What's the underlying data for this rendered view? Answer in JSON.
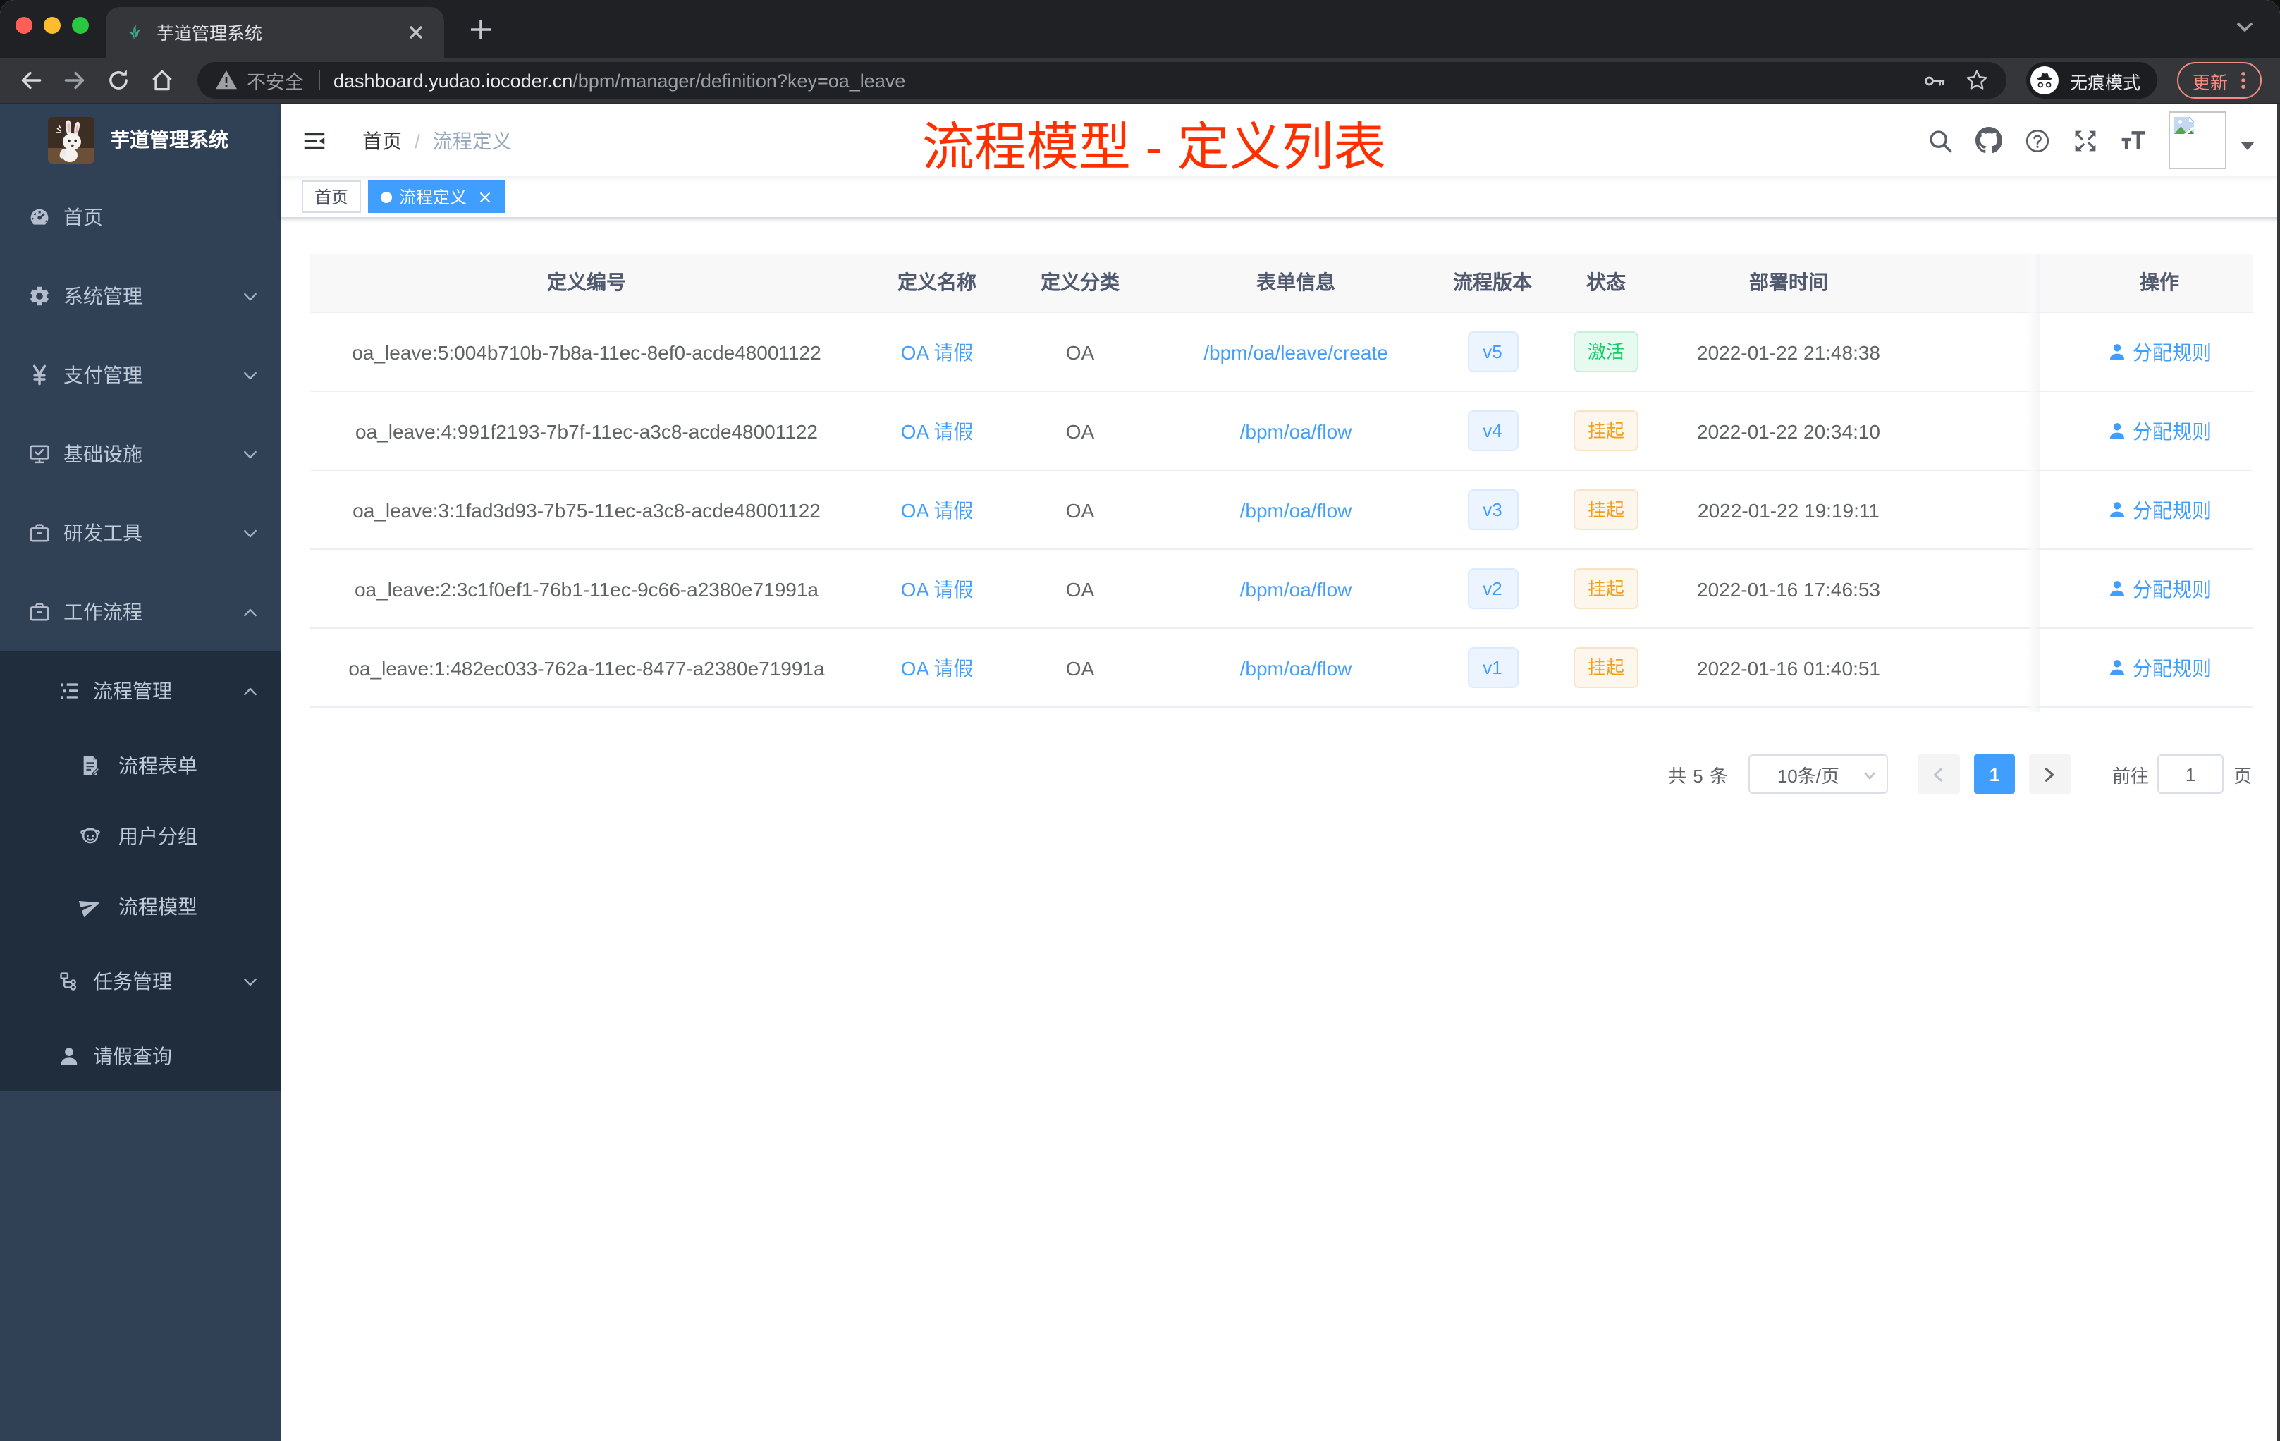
{
  "accent": {
    "blue": "#409eff",
    "green": "#13ce66",
    "orange": "#f0a020",
    "red_annotation": "#ff3000",
    "sidebar_bg": "#304156",
    "sidebar_sub_bg": "#1f2d3d"
  },
  "browser": {
    "tab_title": "芋道管理系统",
    "security_label": "不安全",
    "url_host": "dashboard.yudao.iocoder.cn",
    "url_path": "/bpm/manager/definition?key=oa_leave",
    "incognito_label": "无痕模式",
    "update_label": "更新"
  },
  "sidebar": {
    "logo_title": "芋道管理系统",
    "items": [
      {
        "label": "首页",
        "icon": "dashboard",
        "level": 1,
        "arrow": "",
        "dark": false
      },
      {
        "label": "系统管理",
        "icon": "gear",
        "level": 1,
        "arrow": "down",
        "dark": false
      },
      {
        "label": "支付管理",
        "icon": "yen",
        "level": 1,
        "arrow": "down",
        "dark": false
      },
      {
        "label": "基础设施",
        "icon": "monitor",
        "level": 1,
        "arrow": "down",
        "dark": false
      },
      {
        "label": "研发工具",
        "icon": "briefcase",
        "level": 1,
        "arrow": "down",
        "dark": false
      },
      {
        "label": "工作流程",
        "icon": "briefcase",
        "level": 1,
        "arrow": "up",
        "dark": false
      },
      {
        "label": "流程管理",
        "icon": "tree-list",
        "level": 2,
        "arrow": "up",
        "dark": true
      },
      {
        "label": "流程表单",
        "icon": "form-doc",
        "level": 3,
        "arrow": "",
        "dark": true
      },
      {
        "label": "用户分组",
        "icon": "user-group",
        "level": 3,
        "arrow": "",
        "dark": true
      },
      {
        "label": "流程模型",
        "icon": "paper-plane",
        "level": 3,
        "arrow": "",
        "dark": true
      },
      {
        "label": "任务管理",
        "icon": "flow-tree",
        "level": 2,
        "arrow": "down",
        "dark": true
      },
      {
        "label": "请假查询",
        "icon": "user",
        "level": 2,
        "arrow": "",
        "dark": true,
        "short": true
      }
    ]
  },
  "header": {
    "breadcrumb_home": "首页",
    "breadcrumb_separator": "/",
    "breadcrumb_current": "流程定义",
    "annotation": "流程模型 - 定义列表"
  },
  "tags": [
    {
      "label": "首页",
      "active": false,
      "closable": false
    },
    {
      "label": "流程定义",
      "active": true,
      "closable": true
    }
  ],
  "table": {
    "columns": [
      "定义编号",
      "定义名称",
      "定义分类",
      "表单信息",
      "流程版本",
      "状态",
      "部署时间",
      "操作"
    ],
    "rows": [
      {
        "id": "oa_leave:5:004b710b-7b8a-11ec-8ef0-acde48001122",
        "name": "OA 请假",
        "category": "OA",
        "form": "/bpm/oa/leave/create",
        "version": "v5",
        "status": "激活",
        "status_type": "success",
        "deployed": "2022-01-22 21:48:38",
        "action": "分配规则"
      },
      {
        "id": "oa_leave:4:991f2193-7b7f-11ec-a3c8-acde48001122",
        "name": "OA 请假",
        "category": "OA",
        "form": "/bpm/oa/flow",
        "version": "v4",
        "status": "挂起",
        "status_type": "warning",
        "deployed": "2022-01-22 20:34:10",
        "action": "分配规则"
      },
      {
        "id": "oa_leave:3:1fad3d93-7b75-11ec-a3c8-acde48001122",
        "name": "OA 请假",
        "category": "OA",
        "form": "/bpm/oa/flow",
        "version": "v3",
        "status": "挂起",
        "status_type": "warning",
        "deployed": "2022-01-22 19:19:11",
        "action": "分配规则"
      },
      {
        "id": "oa_leave:2:3c1f0ef1-76b1-11ec-9c66-a2380e71991a",
        "name": "OA 请假",
        "category": "OA",
        "form": "/bpm/oa/flow",
        "version": "v2",
        "status": "挂起",
        "status_type": "warning",
        "deployed": "2022-01-16 17:46:53",
        "action": "分配规则"
      },
      {
        "id": "oa_leave:1:482ec033-762a-11ec-8477-a2380e71991a",
        "name": "OA 请假",
        "category": "OA",
        "form": "/bpm/oa/flow",
        "version": "v1",
        "status": "挂起",
        "status_type": "warning",
        "deployed": "2022-01-16 01:40:51",
        "action": "分配规则"
      }
    ]
  },
  "pagination": {
    "total": "共 5 条",
    "page_size": "10条/页",
    "current_page": "1",
    "goto_label": "前往",
    "goto_value": "1",
    "page_unit": "页"
  }
}
